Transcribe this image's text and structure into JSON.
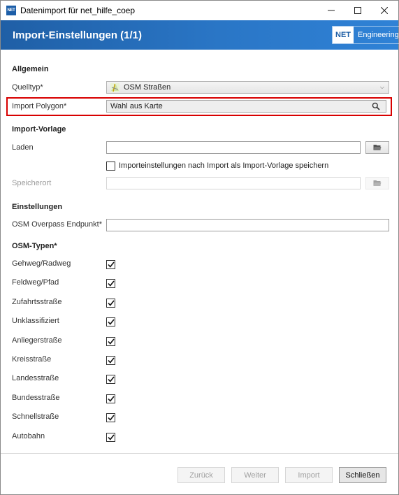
{
  "window": {
    "icon_text": "NET",
    "title": "Datenimport für net_hilfe_coep"
  },
  "header": {
    "title": "Import-Einstellungen (1/1)",
    "brand_net": "NET",
    "brand_text": "Engineering"
  },
  "general": {
    "section": "Allgemein",
    "source_type_label": "Quelltyp*",
    "source_type_value": "OSM Straßen",
    "polygon_label": "Import Polygon*",
    "polygon_value": "Wahl aus Karte"
  },
  "template": {
    "section": "Import-Vorlage",
    "load_label": "Laden",
    "load_value": "",
    "save_checkbox_label": "Importeinstellungen nach Import als Import-Vorlage speichern",
    "save_checked": false,
    "location_label": "Speicherort",
    "location_value": ""
  },
  "settings": {
    "section": "Einstellungen",
    "endpoint_label": "OSM Overpass Endpunkt*",
    "endpoint_value": ""
  },
  "osm_types": {
    "section": "OSM-Typen*",
    "items": [
      {
        "label": "Gehweg/Radweg",
        "checked": true
      },
      {
        "label": "Feldweg/Pfad",
        "checked": true
      },
      {
        "label": "Zufahrtsstraße",
        "checked": true
      },
      {
        "label": "Unklassifiziert",
        "checked": true
      },
      {
        "label": "Anliegerstraße",
        "checked": true
      },
      {
        "label": "Kreisstraße",
        "checked": true
      },
      {
        "label": "Landesstraße",
        "checked": true
      },
      {
        "label": "Bundesstraße",
        "checked": true
      },
      {
        "label": "Schnellstraße",
        "checked": true
      },
      {
        "label": "Autobahn",
        "checked": true
      }
    ]
  },
  "footer": {
    "back": "Zurück",
    "next": "Weiter",
    "import": "Import",
    "close": "Schließen"
  },
  "colors": {
    "header_blue": "#1f5fa6",
    "highlight_red": "#d80000"
  },
  "icons": {
    "app": "net-logo-icon",
    "minimize": "minimize-icon",
    "maximize": "maximize-icon",
    "close": "close-icon",
    "osm": "osm-road-icon",
    "search": "search-icon",
    "folder": "folder-open-icon",
    "dropdown": "chevron-down-icon",
    "check": "checkmark-icon"
  }
}
